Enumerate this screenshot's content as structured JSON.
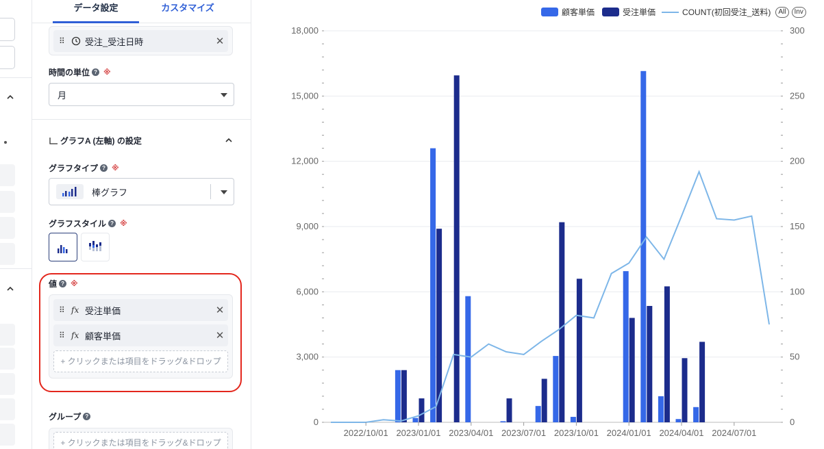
{
  "tabs": {
    "data": "データ設定",
    "customize": "カスタマイズ"
  },
  "date_field": {
    "label": "受注_受注日時"
  },
  "time_unit": {
    "label": "時間の単位",
    "required": "※",
    "value": "月"
  },
  "graph_a": {
    "title": "グラフA (左軸) の設定"
  },
  "graph_type": {
    "label": "グラフタイプ",
    "required": "※",
    "value": "棒グラフ"
  },
  "graph_style": {
    "label": "グラフスタイル",
    "required": "※"
  },
  "values_section": {
    "label": "値",
    "required": "※",
    "items": [
      "受注単価",
      "顧客単価"
    ],
    "dropzone": "+ クリックまたは項目をドラッグ&ドロップ"
  },
  "group_section": {
    "label": "グループ",
    "dropzone": "+ クリックまたは項目をドラッグ&ドロップ"
  },
  "legend": {
    "items": [
      "顧客単価",
      "受注単価",
      "COUNT(初回受注_送料)"
    ],
    "all": "All",
    "inv": "Inv"
  },
  "colors": {
    "customer": "#3568e8",
    "order": "#1c2c8c",
    "count": "#7db6e8",
    "accent": "#2f5fd6",
    "highlight": "#e3261c"
  },
  "chart_data": {
    "type": "bar",
    "x_tick_labels": [
      "2022/10/01",
      "2023/01/01",
      "2023/04/01",
      "2023/07/01",
      "2023/10/01",
      "2024/01/01",
      "2024/04/01",
      "2024/07/01"
    ],
    "y_left": {
      "ticks": [
        0,
        3000,
        6000,
        9000,
        12000,
        15000,
        18000
      ],
      "tick_labels": [
        "0",
        "3,000",
        "6,000",
        "9,000",
        "12,000",
        "15,000",
        "18,000"
      ],
      "range": [
        0,
        18000
      ]
    },
    "y_right": {
      "ticks": [
        0,
        50,
        100,
        150,
        200,
        250,
        300
      ],
      "tick_labels": [
        "0",
        "50",
        "100",
        "150",
        "200",
        "250",
        "300"
      ],
      "range": [
        0,
        300
      ]
    },
    "months": [
      "2022/08",
      "2022/09",
      "2022/10",
      "2022/11",
      "2022/12",
      "2023/01",
      "2023/02",
      "2023/03",
      "2023/04",
      "2023/05",
      "2023/06",
      "2023/07",
      "2023/08",
      "2023/09",
      "2023/10",
      "2023/11",
      "2023/12",
      "2024/01",
      "2024/02",
      "2024/03",
      "2024/04",
      "2024/05",
      "2024/06",
      "2024/07",
      "2024/08",
      "2024/09"
    ],
    "series": [
      {
        "name": "顧客単価",
        "axis": "left",
        "type": "bar",
        "values": [
          0,
          0,
          0,
          0,
          2400,
          200,
          12600,
          0,
          5800,
          0,
          50,
          0,
          750,
          3050,
          250,
          0,
          0,
          6950,
          16150,
          1200,
          150,
          700,
          0,
          0,
          0,
          0
        ]
      },
      {
        "name": "受注単価",
        "axis": "left",
        "type": "bar",
        "values": [
          0,
          0,
          0,
          0,
          2400,
          1100,
          8900,
          15950,
          0,
          0,
          1100,
          0,
          2000,
          9200,
          6600,
          0,
          0,
          4800,
          5350,
          6250,
          2950,
          3700,
          0,
          0,
          0,
          0
        ]
      },
      {
        "name": "COUNT(初回受注_送料)",
        "axis": "right",
        "type": "line",
        "values": [
          0,
          0,
          0,
          2,
          1,
          5,
          12,
          52,
          50,
          60,
          54,
          52,
          62,
          71,
          82,
          80,
          114,
          122,
          142,
          125,
          158,
          192,
          156,
          155,
          158,
          75
        ]
      }
    ]
  }
}
